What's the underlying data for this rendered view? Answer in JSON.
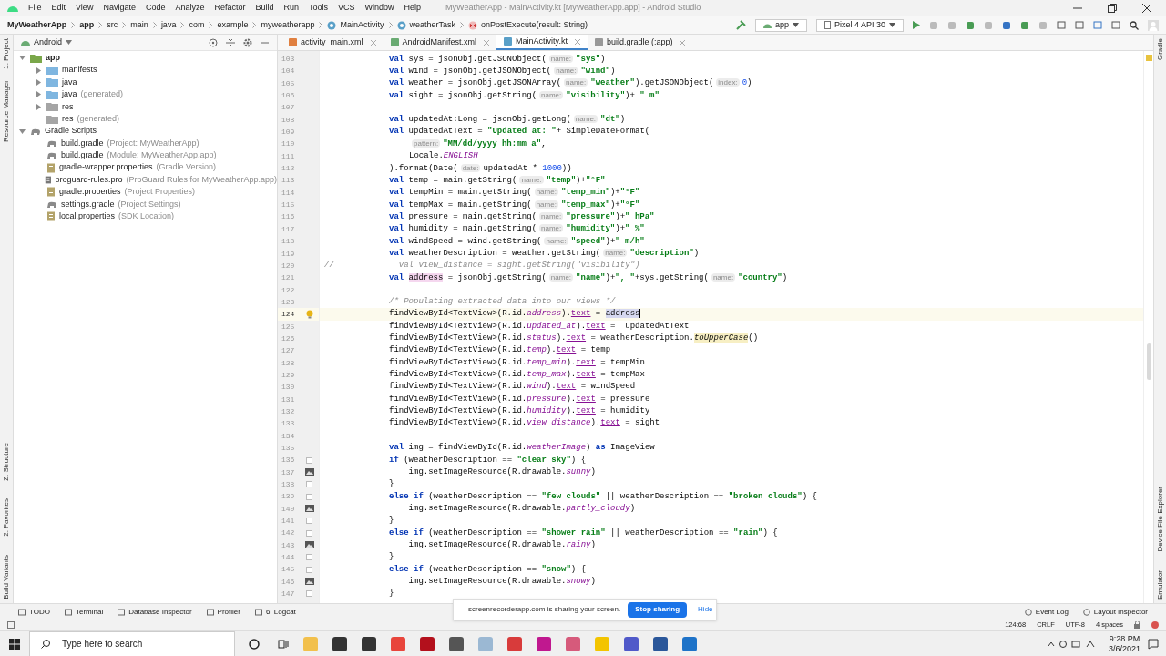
{
  "window": {
    "title": "MyWeatherApp - MainActivity.kt [MyWeatherApp.app] - Android Studio"
  },
  "menu": [
    "File",
    "Edit",
    "View",
    "Navigate",
    "Code",
    "Analyze",
    "Refactor",
    "Build",
    "Run",
    "Tools",
    "VCS",
    "Window",
    "Help"
  ],
  "breadcrumb": [
    {
      "label": "MyWeatherApp",
      "kind": "project"
    },
    {
      "label": "app",
      "kind": "module"
    },
    {
      "label": "src",
      "kind": "plain"
    },
    {
      "label": "main",
      "kind": "plain"
    },
    {
      "label": "java",
      "kind": "plain"
    },
    {
      "label": "com",
      "kind": "plain"
    },
    {
      "label": "example",
      "kind": "plain"
    },
    {
      "label": "myweatherapp",
      "kind": "plain"
    },
    {
      "label": "MainActivity",
      "kind": "class"
    },
    {
      "label": "weatherTask",
      "kind": "class"
    },
    {
      "label": "onPostExecute(result: String)",
      "kind": "method"
    }
  ],
  "toolbar": {
    "run_config": "app",
    "device": "Pixel 4 API 30"
  },
  "left_stripe": [
    "1: Project",
    "Resource Manager",
    "Z: Structure",
    "2: Favorites",
    "Build Variants"
  ],
  "right_stripe": [
    "Gradle",
    "Device File Explorer",
    "Emulator"
  ],
  "project": {
    "view": "Android",
    "tree": [
      {
        "label": "app",
        "kind": "module",
        "expanded": true,
        "children": [
          {
            "label": "manifests",
            "kind": "folder",
            "expanded": false
          },
          {
            "label": "java",
            "kind": "folder",
            "expanded": false
          },
          {
            "label": "java",
            "note": "(generated)",
            "kind": "folder",
            "expanded": false
          },
          {
            "label": "res",
            "kind": "res",
            "expanded": false
          },
          {
            "label": "res",
            "note": "(generated)",
            "kind": "res"
          }
        ]
      },
      {
        "label": "Gradle Scripts",
        "kind": "gradle",
        "expanded": true,
        "children": [
          {
            "label": "build.gradle",
            "note": "(Project: MyWeatherApp)",
            "kind": "gradle"
          },
          {
            "label": "build.gradle",
            "note": "(Module: MyWeatherApp.app)",
            "kind": "gradle"
          },
          {
            "label": "gradle-wrapper.properties",
            "note": "(Gradle Version)",
            "kind": "properties"
          },
          {
            "label": "proguard-rules.pro",
            "note": "(ProGuard Rules for MyWeatherApp.app)",
            "kind": "file"
          },
          {
            "label": "gradle.properties",
            "note": "(Project Properties)",
            "kind": "properties"
          },
          {
            "label": "settings.gradle",
            "note": "(Project Settings)",
            "kind": "gradle"
          },
          {
            "label": "local.properties",
            "note": "(SDK Location)",
            "kind": "properties"
          }
        ]
      }
    ]
  },
  "tabs": [
    {
      "label": "activity_main.xml",
      "kind": "xml",
      "selected": false
    },
    {
      "label": "AndroidManifest.xml",
      "kind": "manifest",
      "selected": false
    },
    {
      "label": "MainActivity.kt",
      "kind": "kotlin",
      "selected": true
    },
    {
      "label": "build.gradle (:app)",
      "kind": "gradle",
      "selected": false
    }
  ],
  "code": [
    {
      "number": "103",
      "current": false,
      "parts": [
        {
          "kind": "keyword",
          "text": "val"
        },
        {
          "kind": "plain",
          "text": " sys = jsonObj.getJSONObject("
        },
        {
          "kind": "hint",
          "text": "name:"
        },
        {
          "kind": "string",
          "text": "\"sys\""
        },
        {
          "kind": "plain",
          "text": ")"
        }
      ]
    },
    {
      "number": "104",
      "current": false,
      "parts": [
        {
          "kind": "keyword",
          "text": "val"
        },
        {
          "kind": "plain",
          "text": " wind = jsonObj.getJSONObject("
        },
        {
          "kind": "hint",
          "text": "name:"
        },
        {
          "kind": "string",
          "text": "\"wind\""
        },
        {
          "kind": "plain",
          "text": ")"
        }
      ]
    },
    {
      "number": "105",
      "current": false,
      "parts": [
        {
          "kind": "keyword",
          "text": "val"
        },
        {
          "kind": "plain",
          "text": " weather = jsonObj.getJSONArray("
        },
        {
          "kind": "hint",
          "text": "name:"
        },
        {
          "kind": "string",
          "text": "\"weather\""
        },
        {
          "kind": "plain",
          "text": ").getJSONObject("
        },
        {
          "kind": "hint",
          "text": "index:"
        },
        {
          "kind": "number",
          "text": "0"
        },
        {
          "kind": "plain",
          "text": ")"
        }
      ]
    },
    {
      "number": "106",
      "current": false,
      "parts": [
        {
          "kind": "keyword",
          "text": "val"
        },
        {
          "kind": "plain",
          "text": " sight = jsonObj.getString("
        },
        {
          "kind": "hint",
          "text": "name:"
        },
        {
          "kind": "string",
          "text": "\"visibility\""
        },
        {
          "kind": "plain",
          "text": ")+ "
        },
        {
          "kind": "string",
          "text": "\" m\""
        }
      ]
    },
    {
      "number": "107",
      "current": false
    },
    {
      "number": "108",
      "current": false,
      "parts": [
        {
          "kind": "keyword",
          "text": "val"
        },
        {
          "kind": "plain",
          "text": " updatedAt:Long = jsonObj.getLong("
        },
        {
          "kind": "hint",
          "text": "name:"
        },
        {
          "kind": "string",
          "text": "\"dt\""
        },
        {
          "kind": "plain",
          "text": ")"
        }
      ]
    },
    {
      "number": "109",
      "current": false,
      "parts": [
        {
          "kind": "keyword",
          "text": "val"
        },
        {
          "kind": "plain",
          "text": " updatedAtText = "
        },
        {
          "kind": "string",
          "text": "\"Updated at: \""
        },
        {
          "kind": "plain",
          "text": "+ SimpleDateFormat("
        }
      ]
    },
    {
      "number": "110",
      "current": false,
      "continuation": true,
      "parts": [
        {
          "kind": "hint",
          "text": "pattern:"
        },
        {
          "kind": "string",
          "text": "\"MM/dd/yyyy hh:mm a\""
        },
        {
          "kind": "plain",
          "text": ","
        }
      ]
    },
    {
      "number": "111",
      "current": false,
      "continuation": true,
      "parts": [
        {
          "kind": "plain",
          "text": "Locale."
        },
        {
          "kind": "italic",
          "text": "ENGLISH"
        }
      ]
    },
    {
      "number": "112",
      "current": false,
      "parts": [
        {
          "kind": "plain",
          "text": ").format(Date("
        },
        {
          "kind": "hint",
          "text": "date:"
        },
        {
          "kind": "plain",
          "text": "updatedAt * "
        },
        {
          "kind": "number",
          "text": "1000"
        },
        {
          "kind": "plain",
          "text": "))"
        }
      ]
    },
    {
      "number": "113",
      "current": false,
      "parts": [
        {
          "kind": "keyword",
          "text": "val"
        },
        {
          "kind": "plain",
          "text": " temp = main.getString("
        },
        {
          "kind": "hint",
          "text": "name:"
        },
        {
          "kind": "string",
          "text": "\"temp\""
        },
        {
          "kind": "plain",
          "text": ")+"
        },
        {
          "kind": "string",
          "text": "\"°F\""
        }
      ]
    },
    {
      "number": "114",
      "current": false,
      "parts": [
        {
          "kind": "keyword",
          "text": "val"
        },
        {
          "kind": "plain",
          "text": " tempMin = main.getString("
        },
        {
          "kind": "hint",
          "text": "name:"
        },
        {
          "kind": "string",
          "text": "\"temp_min\""
        },
        {
          "kind": "plain",
          "text": ")+"
        },
        {
          "kind": "string",
          "text": "\"°F\""
        }
      ]
    },
    {
      "number": "115",
      "current": false,
      "parts": [
        {
          "kind": "keyword",
          "text": "val"
        },
        {
          "kind": "plain",
          "text": " tempMax = main.getString("
        },
        {
          "kind": "hint",
          "text": "name:"
        },
        {
          "kind": "string",
          "text": "\"temp_max\""
        },
        {
          "kind": "plain",
          "text": ")+"
        },
        {
          "kind": "string",
          "text": "\"°F\""
        }
      ]
    },
    {
      "number": "116",
      "current": false,
      "parts": [
        {
          "kind": "keyword",
          "text": "val"
        },
        {
          "kind": "plain",
          "text": " pressure = main.getString("
        },
        {
          "kind": "hint",
          "text": "name:"
        },
        {
          "kind": "string",
          "text": "\"pressure\""
        },
        {
          "kind": "plain",
          "text": ")+"
        },
        {
          "kind": "string",
          "text": "\" hPa\""
        }
      ]
    },
    {
      "number": "117",
      "current": false,
      "parts": [
        {
          "kind": "keyword",
          "text": "val"
        },
        {
          "kind": "plain",
          "text": " humidity = main.getString("
        },
        {
          "kind": "hint",
          "text": "name:"
        },
        {
          "kind": "string",
          "text": "\"humidity\""
        },
        {
          "kind": "plain",
          "text": ")+"
        },
        {
          "kind": "string",
          "text": "\" %\""
        }
      ]
    },
    {
      "number": "118",
      "current": false,
      "parts": [
        {
          "kind": "keyword",
          "text": "val"
        },
        {
          "kind": "plain",
          "text": " windSpeed = wind.getString("
        },
        {
          "kind": "hint",
          "text": "name:"
        },
        {
          "kind": "string",
          "text": "\"speed\""
        },
        {
          "kind": "plain",
          "text": ")+"
        },
        {
          "kind": "string",
          "text": "\" m/h\""
        }
      ]
    },
    {
      "number": "119",
      "current": false,
      "parts": [
        {
          "kind": "keyword",
          "text": "val"
        },
        {
          "kind": "plain",
          "text": " weatherDescription = weather.getString("
        },
        {
          "kind": "hint",
          "text": "name:"
        },
        {
          "kind": "string",
          "text": "\"description\""
        },
        {
          "kind": "plain",
          "text": ")"
        }
      ]
    },
    {
      "number": "120",
      "current": false,
      "margin": "//",
      "parts": [
        {
          "kind": "comment",
          "text": "  val view_distance = sight.getString(\"visibility\")"
        }
      ]
    },
    {
      "number": "121",
      "current": false,
      "parts": [
        {
          "kind": "keyword",
          "text": "val "
        },
        {
          "kind": "marked",
          "text": "address"
        },
        {
          "kind": "plain",
          "text": " = jsonObj.getString("
        },
        {
          "kind": "hint",
          "text": "name:"
        },
        {
          "kind": "string",
          "text": "\"name\""
        },
        {
          "kind": "plain",
          "text": ")+"
        },
        {
          "kind": "string",
          "text": "\", \""
        },
        {
          "kind": "plain",
          "text": "+sys.getString("
        },
        {
          "kind": "hint",
          "text": "name:"
        },
        {
          "kind": "string",
          "text": "\"country\""
        },
        {
          "kind": "plain",
          "text": ")"
        }
      ]
    },
    {
      "number": "122",
      "current": false
    },
    {
      "number": "123",
      "current": false,
      "parts": [
        {
          "kind": "comment",
          "text": "/* Populating extracted data into our views */"
        }
      ]
    },
    {
      "number": "124",
      "current": true,
      "kind": "bulb",
      "parts": [
        {
          "kind": "plain",
          "text": "findViewById<TextView>(R.id."
        },
        {
          "kind": "italic",
          "text": "address"
        },
        {
          "kind": "plain",
          "text": ")."
        },
        {
          "kind": "property",
          "text": "text"
        },
        {
          "kind": "plain",
          "text": " = "
        },
        {
          "kind": "selection",
          "text": "address"
        }
      ]
    },
    {
      "number": "125",
      "current": false,
      "parts": [
        {
          "kind": "plain",
          "text": "findViewById<TextView>(R.id."
        },
        {
          "kind": "italic",
          "text": "updated_at"
        },
        {
          "kind": "plain",
          "text": ")."
        },
        {
          "kind": "property",
          "text": "text"
        },
        {
          "kind": "plain",
          "text": " =  updatedAtText"
        }
      ]
    },
    {
      "number": "126",
      "current": false,
      "parts": [
        {
          "kind": "plain",
          "text": "findViewById<TextView>(R.id."
        },
        {
          "kind": "italic",
          "text": "status"
        },
        {
          "kind": "plain",
          "text": ")."
        },
        {
          "kind": "property",
          "text": "text"
        },
        {
          "kind": "plain",
          "text": " = weatherDescription."
        },
        {
          "kind": "deprecated",
          "text": "toUpperCase"
        },
        {
          "kind": "plain",
          "text": "()"
        }
      ]
    },
    {
      "number": "127",
      "current": false,
      "parts": [
        {
          "kind": "plain",
          "text": "findViewById<TextView>(R.id."
        },
        {
          "kind": "italic",
          "text": "temp"
        },
        {
          "kind": "plain",
          "text": ")."
        },
        {
          "kind": "property",
          "text": "text"
        },
        {
          "kind": "plain",
          "text": " = temp"
        }
      ]
    },
    {
      "number": "128",
      "current": false,
      "parts": [
        {
          "kind": "plain",
          "text": "findViewById<TextView>(R.id."
        },
        {
          "kind": "italic",
          "text": "temp_min"
        },
        {
          "kind": "plain",
          "text": ")."
        },
        {
          "kind": "property",
          "text": "text"
        },
        {
          "kind": "plain",
          "text": " = tempMin"
        }
      ]
    },
    {
      "number": "129",
      "current": false,
      "parts": [
        {
          "kind": "plain",
          "text": "findViewById<TextView>(R.id."
        },
        {
          "kind": "italic",
          "text": "temp_max"
        },
        {
          "kind": "plain",
          "text": ")."
        },
        {
          "kind": "property",
          "text": "text"
        },
        {
          "kind": "plain",
          "text": " = tempMax"
        }
      ]
    },
    {
      "number": "130",
      "current": false,
      "parts": [
        {
          "kind": "plain",
          "text": "findViewById<TextView>(R.id."
        },
        {
          "kind": "italic",
          "text": "wind"
        },
        {
          "kind": "plain",
          "text": ")."
        },
        {
          "kind": "property",
          "text": "text"
        },
        {
          "kind": "plain",
          "text": " = windSpeed"
        }
      ]
    },
    {
      "number": "131",
      "current": false,
      "parts": [
        {
          "kind": "plain",
          "text": "findViewById<TextView>(R.id."
        },
        {
          "kind": "italic",
          "text": "pressure"
        },
        {
          "kind": "plain",
          "text": ")."
        },
        {
          "kind": "property",
          "text": "text"
        },
        {
          "kind": "plain",
          "text": " = pressure"
        }
      ]
    },
    {
      "number": "132",
      "current": false,
      "parts": [
        {
          "kind": "plain",
          "text": "findViewById<TextView>(R.id."
        },
        {
          "kind": "italic",
          "text": "humidity"
        },
        {
          "kind": "plain",
          "text": ")."
        },
        {
          "kind": "property",
          "text": "text"
        },
        {
          "kind": "plain",
          "text": " = humidity"
        }
      ]
    },
    {
      "number": "133",
      "current": false,
      "parts": [
        {
          "kind": "plain",
          "text": "findViewById<TextView>(R.id."
        },
        {
          "kind": "italic",
          "text": "view_distance"
        },
        {
          "kind": "plain",
          "text": ")."
        },
        {
          "kind": "property",
          "text": "text"
        },
        {
          "kind": "plain",
          "text": " = sight"
        }
      ]
    },
    {
      "number": "134",
      "current": false
    },
    {
      "number": "135",
      "current": false,
      "parts": [
        {
          "kind": "keyword",
          "text": "val"
        },
        {
          "kind": "plain",
          "text": " img = findViewById(R.id."
        },
        {
          "kind": "italic",
          "text": "weatherImage"
        },
        {
          "kind": "plain",
          "text": ") "
        },
        {
          "kind": "keyword",
          "text": "as"
        },
        {
          "kind": "plain",
          "text": " ImageView"
        }
      ]
    },
    {
      "number": "136",
      "current": false,
      "kind": "fold",
      "parts": [
        {
          "kind": "keyword",
          "text": "if"
        },
        {
          "kind": "plain",
          "text": " (weatherDescription == "
        },
        {
          "kind": "string",
          "text": "\"clear sky\""
        },
        {
          "kind": "plain",
          "text": ") {"
        }
      ]
    },
    {
      "number": "137",
      "current": false,
      "kind": "image",
      "parts": [
        {
          "kind": "plain",
          "text": "    img.setImageResource(R.drawable."
        },
        {
          "kind": "italic",
          "text": "sunny"
        },
        {
          "kind": "plain",
          "text": ")"
        }
      ]
    },
    {
      "number": "138",
      "current": false,
      "kind": "fold",
      "parts": [
        {
          "kind": "plain",
          "text": "}"
        }
      ]
    },
    {
      "number": "139",
      "current": false,
      "kind": "fold",
      "parts": [
        {
          "kind": "keyword",
          "text": "else if"
        },
        {
          "kind": "plain",
          "text": " (weatherDescription == "
        },
        {
          "kind": "string",
          "text": "\"few clouds\""
        },
        {
          "kind": "plain",
          "text": " || weatherDescription == "
        },
        {
          "kind": "string",
          "text": "\"broken clouds\""
        },
        {
          "kind": "plain",
          "text": ") {"
        }
      ]
    },
    {
      "number": "140",
      "current": false,
      "kind": "image",
      "parts": [
        {
          "kind": "plain",
          "text": "    img.setImageResource(R.drawable."
        },
        {
          "kind": "italic",
          "text": "partly_cloudy"
        },
        {
          "kind": "plain",
          "text": ")"
        }
      ]
    },
    {
      "number": "141",
      "current": false,
      "kind": "fold",
      "parts": [
        {
          "kind": "plain",
          "text": "}"
        }
      ]
    },
    {
      "number": "142",
      "current": false,
      "kind": "fold",
      "parts": [
        {
          "kind": "keyword",
          "text": "else if"
        },
        {
          "kind": "plain",
          "text": " (weatherDescription == "
        },
        {
          "kind": "string",
          "text": "\"shower rain\""
        },
        {
          "kind": "plain",
          "text": " || weatherDescription == "
        },
        {
          "kind": "string",
          "text": "\"rain\""
        },
        {
          "kind": "plain",
          "text": ") {"
        }
      ]
    },
    {
      "number": "143",
      "current": false,
      "kind": "image",
      "parts": [
        {
          "kind": "plain",
          "text": "    img.setImageResource(R.drawable."
        },
        {
          "kind": "italic",
          "text": "rainy"
        },
        {
          "kind": "plain",
          "text": ")"
        }
      ]
    },
    {
      "number": "144",
      "current": false,
      "kind": "fold",
      "parts": [
        {
          "kind": "plain",
          "text": "}"
        }
      ]
    },
    {
      "number": "145",
      "current": false,
      "kind": "fold",
      "parts": [
        {
          "kind": "keyword",
          "text": "else if"
        },
        {
          "kind": "plain",
          "text": " (weatherDescription == "
        },
        {
          "kind": "string",
          "text": "\"snow\""
        },
        {
          "kind": "plain",
          "text": ") {"
        }
      ]
    },
    {
      "number": "146",
      "current": false,
      "kind": "image",
      "parts": [
        {
          "kind": "plain",
          "text": "    img.setImageResource(R.drawable."
        },
        {
          "kind": "italic",
          "text": "snowy"
        },
        {
          "kind": "plain",
          "text": ")"
        }
      ]
    },
    {
      "number": "147",
      "current": false,
      "kind": "fold",
      "parts": [
        {
          "kind": "plain",
          "text": "}"
        }
      ]
    }
  ],
  "bottom_tools": {
    "left": [
      "TODO",
      "Terminal",
      "Database Inspector",
      "Profiler",
      "6: Logcat"
    ],
    "right": [
      "Event Log",
      "Layout Inspector"
    ]
  },
  "sharing": {
    "message": "screenrecorderapp.com is sharing your screen.",
    "stop": "Stop sharing",
    "hide": "Hide"
  },
  "status_bar": [
    "124:68",
    "CRLF",
    "UTF-8",
    "4 spaces"
  ],
  "taskbar": {
    "search_placeholder": "Type here to search",
    "time": "9:28 PM",
    "date": "3/6/2021"
  }
}
